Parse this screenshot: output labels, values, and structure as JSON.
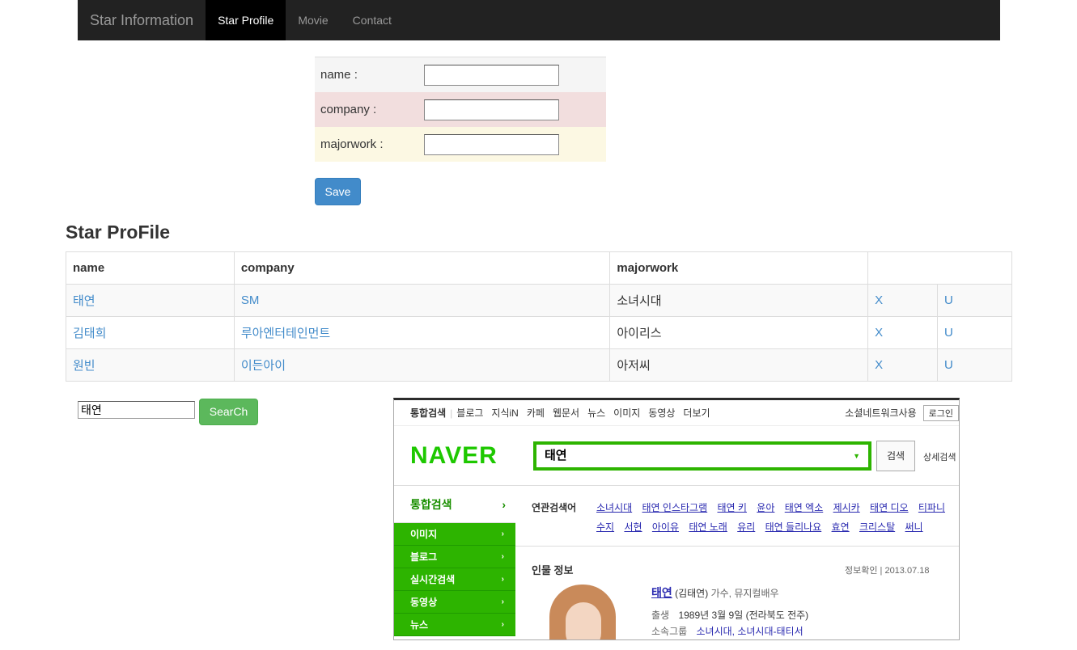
{
  "navbar": {
    "brand": "Star Information",
    "items": [
      {
        "label": "Star Profile",
        "active": true
      },
      {
        "label": "Movie",
        "active": false
      },
      {
        "label": "Contact",
        "active": false
      }
    ]
  },
  "form": {
    "name_label": "name :",
    "company_label": "company :",
    "majorwork_label": "majorwork :",
    "name_value": "",
    "company_value": "",
    "majorwork_value": "",
    "save_label": "Save"
  },
  "section_title": "Star ProFile",
  "table": {
    "headers": [
      "name",
      "company",
      "majorwork",
      ""
    ],
    "rows": [
      {
        "name": "태연",
        "company": "SM",
        "majorwork": "소녀시대",
        "delete": "X",
        "update": "U"
      },
      {
        "name": "김태희",
        "company": "루아엔터테인먼트",
        "majorwork": "아이리스",
        "delete": "X",
        "update": "U"
      },
      {
        "name": "원빈",
        "company": "이든아이",
        "majorwork": "아저씨",
        "delete": "X",
        "update": "U"
      }
    ]
  },
  "search": {
    "value": "태연",
    "button_label": "SearCh"
  },
  "naver": {
    "top_items": [
      "통합검색",
      "블로그",
      "지식iN",
      "카페",
      "웹문서",
      "뉴스",
      "이미지",
      "동영상",
      "더보기"
    ],
    "top_right": "소셜네트워크사용",
    "login": "로그인",
    "logo": "NAVER",
    "query": "태연",
    "search_btn": "검색",
    "advanced": "상세검색",
    "side_main": "통합검색",
    "side_items": [
      "이미지",
      "블로그",
      "실시간검색",
      "동영상",
      "뉴스"
    ],
    "related_label": "연관검색어",
    "related_row1": [
      "소녀시대",
      "태연 인스타그램",
      "태연 키",
      "윤아",
      "태연 엑소",
      "제시카",
      "태연 디오",
      "티파니"
    ],
    "related_row2": [
      "수지",
      "서현",
      "아이유",
      "태연 노래",
      "유리",
      "태연 들리나요",
      "효연",
      "크리스탈",
      "써니"
    ],
    "person_title": "인물 정보",
    "confirm": "정보확인 | 2013.07.18",
    "person_name": "태연",
    "person_real": "(김태연)",
    "person_job": "가수, 뮤지컬배우",
    "birth_key": "출생",
    "birth_val": "1989년 3월 9일 (전라북도 전주)",
    "group_key": "소속그룹",
    "group_val": "소녀시대, 소녀시대-태티서"
  }
}
